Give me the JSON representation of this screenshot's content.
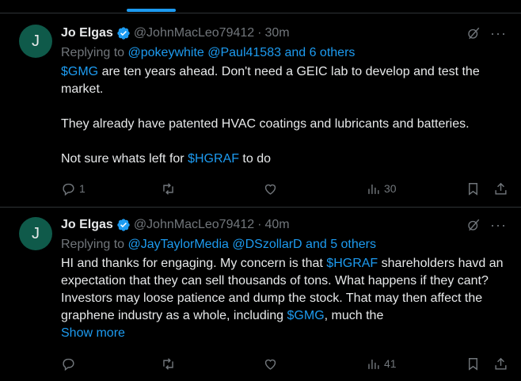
{
  "tweets": [
    {
      "avatar_letter": "J",
      "name": "Jo Elgas",
      "handle": "@JohnMacLeo79412",
      "time": "30m",
      "replying_prefix": "Replying to",
      "replying_links": "@pokeywhite @Paul41583 and 6 others",
      "lines": {
        "l1_tag": "$GMG",
        "l1_rest": " are ten years ahead. Don't need a GEIC lab to develop and test the market.",
        "l2": "They already have patented HVAC coatings and lubricants and batteries.",
        "l3_pre": "Not sure whats left for ",
        "l3_tag": "$HGRAF",
        "l3_post": " to do"
      },
      "replies": "1",
      "reposts": "",
      "likes": "",
      "views": "30"
    },
    {
      "avatar_letter": "J",
      "name": "Jo Elgas",
      "handle": "@JohnMacLeo79412",
      "time": "40m",
      "replying_prefix": "Replying to",
      "replying_links": "@JayTaylorMedia @DSzollarD and 5 others",
      "lines": {
        "p1_pre": "HI and thanks for engaging. My concern is that ",
        "p1_tag": "$HGRAF",
        "p1_mid": " shareholders havd an expectation that they can sell thousands of tons. What happens if they cant? Investors may loose patience and dump the stock. That may then affect the graphene industry as a whole, including ",
        "p1_tag2": "$GMG",
        "p1_post": ", much the"
      },
      "show_more": "Show more",
      "replies": "",
      "reposts": "",
      "likes": "",
      "views": "41"
    }
  ],
  "colors": {
    "accent": "#1d9bf0",
    "muted": "#71767b",
    "avatar_bg": "#0f5a4a"
  },
  "icons": [
    "verified-badge-icon",
    "grok-icon",
    "more-icon",
    "reply-icon",
    "retweet-icon",
    "like-icon",
    "views-icon",
    "bookmark-icon",
    "share-icon"
  ]
}
